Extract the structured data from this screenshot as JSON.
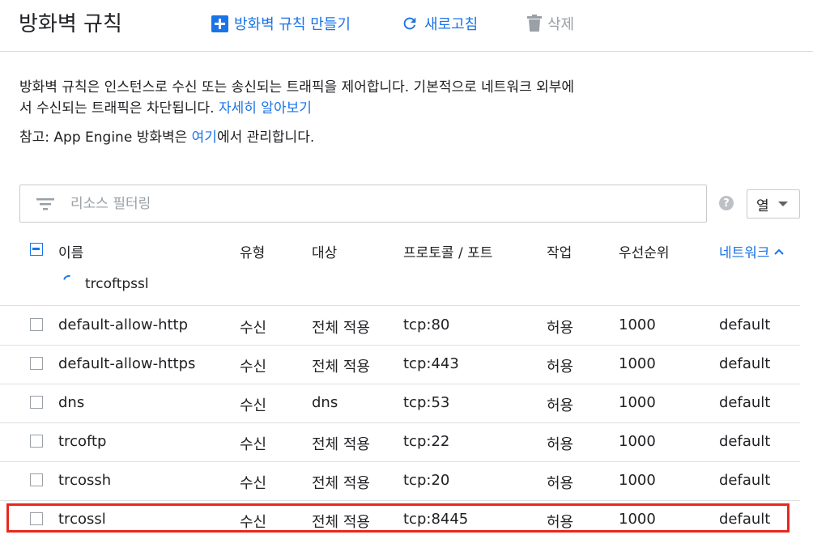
{
  "header": {
    "title": "방화벽 규칙",
    "create_label": "방화벽 규칙 만들기",
    "refresh_label": "새로고침",
    "delete_label": "삭제"
  },
  "description": {
    "text": "방화벽 규칙은 인스턴스로 수신 또는 송신되는 트래픽을 제어합니다. 기본적으로 네트워크 외부에서 수신되는 트래픽은 차단됩니다. ",
    "learn_more": "자세히 알아보기"
  },
  "note": {
    "prefix": "참고: App Engine 방화벽은 ",
    "link": "여기",
    "suffix": "에서 관리합니다."
  },
  "filter": {
    "placeholder": "리소스 필터링"
  },
  "columns_button": {
    "label": "열"
  },
  "table": {
    "headers": [
      "이름",
      "유형",
      "대상",
      "프로토콜 / 포트",
      "작업",
      "우선순위",
      "네트워크"
    ],
    "sorted_column": "네트워크",
    "group_label": "trcoftpssl",
    "rows": [
      {
        "name": "default-allow-http",
        "type": "수신",
        "target": "전체 적용",
        "protocol": "tcp:80",
        "action": "허용",
        "priority": "1000",
        "network": "default"
      },
      {
        "name": "default-allow-https",
        "type": "수신",
        "target": "전체 적용",
        "protocol": "tcp:443",
        "action": "허용",
        "priority": "1000",
        "network": "default"
      },
      {
        "name": "dns",
        "type": "수신",
        "target": "dns",
        "protocol": "tcp:53",
        "action": "허용",
        "priority": "1000",
        "network": "default"
      },
      {
        "name": "trcoftp",
        "type": "수신",
        "target": "전체 적용",
        "protocol": "tcp:22",
        "action": "허용",
        "priority": "1000",
        "network": "default"
      },
      {
        "name": "trcossh",
        "type": "수신",
        "target": "전체 적용",
        "protocol": "tcp:20",
        "action": "허용",
        "priority": "1000",
        "network": "default"
      },
      {
        "name": "trcossl",
        "type": "수신",
        "target": "전체 적용",
        "protocol": "tcp:8445",
        "action": "허용",
        "priority": "1000",
        "network": "default"
      }
    ]
  },
  "colors": {
    "accent": "#1a73e8",
    "highlight": "#e8281e",
    "disabled": "#9aa0a6"
  }
}
